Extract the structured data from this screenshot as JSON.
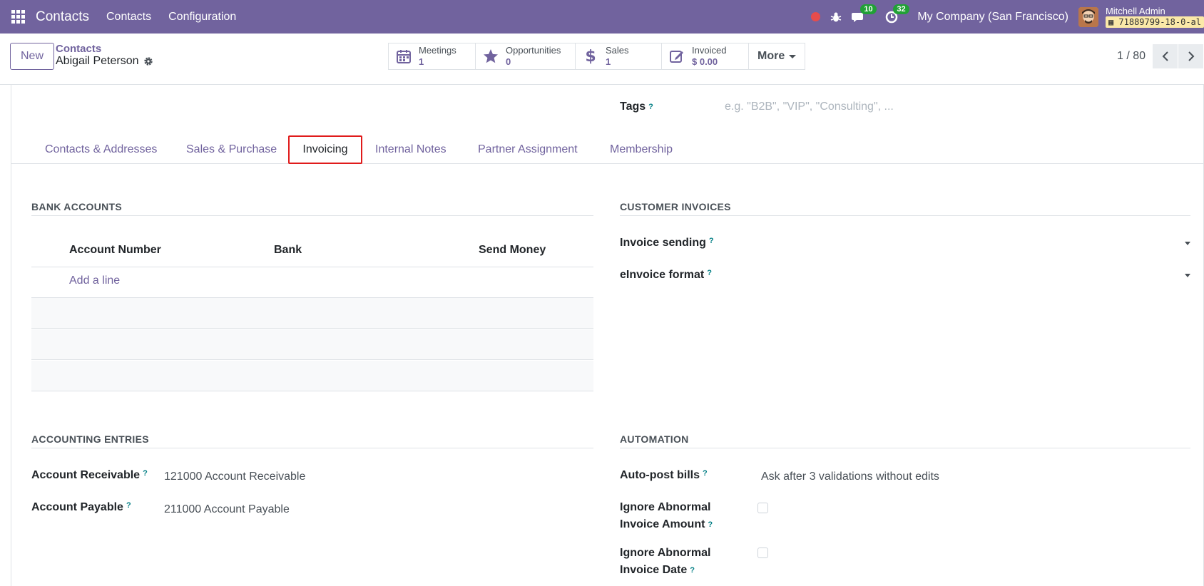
{
  "navbar": {
    "brand": "Contacts",
    "menus": [
      "Contacts",
      "Configuration"
    ],
    "messages_count": "10",
    "activities_count": "32",
    "company": "My Company (San Francisco)",
    "user_name": "Mitchell Admin",
    "db_name": "71889799-18-0-al"
  },
  "control": {
    "new_label": "New",
    "breadcrumb_parent": "Contacts",
    "record_name": "Abigail Peterson",
    "smart_buttons": [
      {
        "label": "Meetings",
        "value": "1",
        "icon": "calendar-icon"
      },
      {
        "label": "Opportunities",
        "value": "0",
        "icon": "star-icon"
      },
      {
        "label": "Sales",
        "value": "1",
        "icon": "dollar-icon"
      },
      {
        "label": "Invoiced",
        "value": "$ 0.00",
        "icon": "pencil-square-icon"
      }
    ],
    "more_label": "More",
    "pager": "1 / 80"
  },
  "form": {
    "tags_label": "Tags",
    "tags_placeholder": "e.g. \"B2B\", \"VIP\", \"Consulting\", ...",
    "tabs": [
      {
        "label": "Contacts & Addresses",
        "active": false
      },
      {
        "label": "Sales & Purchase",
        "active": false
      },
      {
        "label": "Invoicing",
        "active": true
      },
      {
        "label": "Internal Notes",
        "active": false
      },
      {
        "label": "Partner Assignment",
        "active": false
      },
      {
        "label": "Membership",
        "active": false
      }
    ],
    "bank_accounts": {
      "title": "BANK ACCOUNTS",
      "columns": [
        "Account Number",
        "Bank",
        "Send Money"
      ],
      "add_line": "Add a line"
    },
    "customer_invoices": {
      "title": "CUSTOMER INVOICES",
      "invoice_sending_label": "Invoice sending",
      "einvoice_format_label": "eInvoice format"
    },
    "accounting_entries": {
      "title": "ACCOUNTING ENTRIES",
      "receivable_label": "Account Receivable",
      "receivable_value": "121000 Account Receivable",
      "payable_label": "Account Payable",
      "payable_value": "211000 Account Payable"
    },
    "automation": {
      "title": "AUTOMATION",
      "autopost_label": "Auto-post bills",
      "autopost_value": "Ask after 3 validations without edits",
      "ignore_amount_label_1": "Ignore Abnormal",
      "ignore_amount_label_2": "Invoice Amount",
      "ignore_date_label_1": "Ignore Abnormal",
      "ignore_date_label_2": "Invoice Date"
    }
  },
  "colors": {
    "brand": "#71639e",
    "highlight_border": "#e01b1b",
    "badge": "#21a036",
    "help": "#017e84"
  }
}
